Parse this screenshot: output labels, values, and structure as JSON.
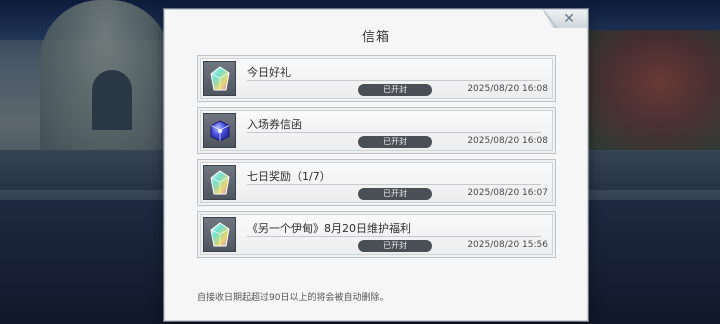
{
  "modal": {
    "title": "信箱",
    "close_label": "✕"
  },
  "mails": [
    {
      "subject": "今日好礼",
      "status": "已开封",
      "time": "2025/08/20 16:08",
      "icon": "prism-crystal-icon"
    },
    {
      "subject": "入场券信函",
      "status": "已开封",
      "time": "2025/08/20 16:08",
      "icon": "blue-cube-ticket-icon"
    },
    {
      "subject": "七日奖励（1/7）",
      "status": "已开封",
      "time": "2025/08/20 16:07",
      "icon": "prism-crystal-icon"
    },
    {
      "subject": "《另一个伊甸》8月20日维护福利",
      "status": "已开封",
      "time": "2025/08/20 15:56",
      "icon": "prism-crystal-icon"
    }
  ],
  "footer": {
    "note": "自接收日期起超过90日以上的将会被自动删除。"
  },
  "colors": {
    "status_pill": "#4a4f55",
    "panel": "#f6f6f6",
    "crystal_a": "#5fd8c8",
    "crystal_b": "#e7d36a",
    "cube": "#3a3fd0"
  }
}
